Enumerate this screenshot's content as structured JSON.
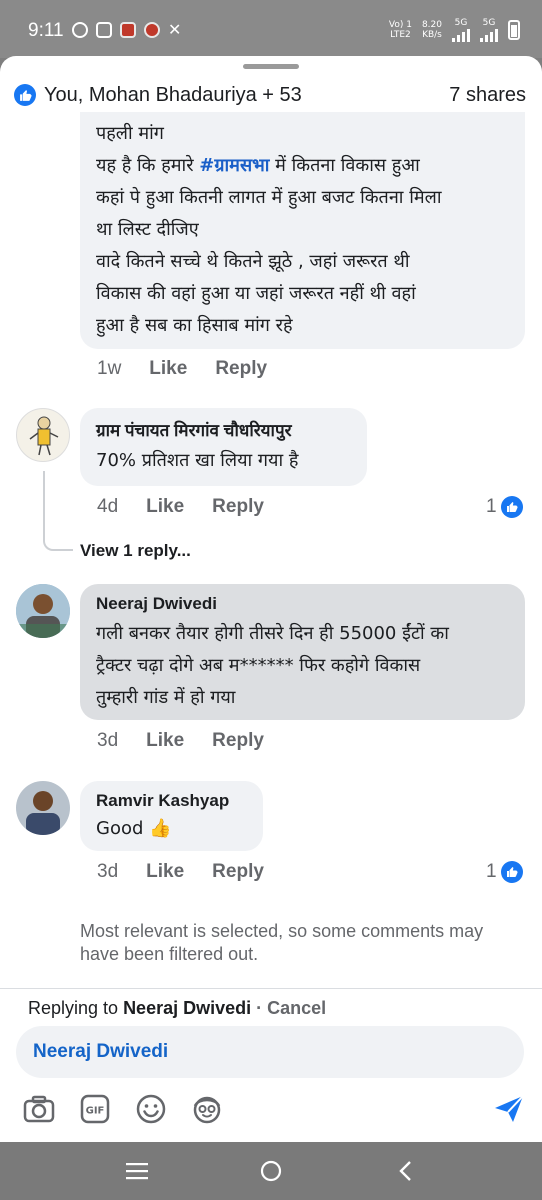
{
  "status_bar": {
    "time": "9:11",
    "network_label": "Vo) 1\nLTE2",
    "speed": "8.20",
    "speed_unit": "KB/s",
    "sim1": "5G",
    "sim2": "5G"
  },
  "header": {
    "reactions": "You, Mohan Bhadauriya + 53",
    "shares": "7 shares"
  },
  "comments": [
    {
      "lines": [
        "पहली मांग",
        "यह है कि हमारे ",
        "#ग्रामसभा",
        " में कितना विकास हुआ",
        "कहां पे हुआ कितनी लागत में हुआ बजट कितना मिला",
        "था लिस्ट दीजिए",
        "वादे कितने सच्चे थे कितने झूठे , जहां जरूरत थी",
        "विकास की वहां हुआ या जहां जरूरत नहीं थी वहां",
        "हुआ है सब का हिसाब मांग रहे"
      ],
      "time": "1w",
      "like": "Like",
      "reply": "Reply"
    },
    {
      "author": "ग्राम पंचायत मिरगांव चौधरियापुर",
      "text": "70% प्रतिशत खा लिया गया है",
      "time": "4d",
      "like": "Like",
      "reply": "Reply",
      "likes_count": "1",
      "view_replies": "View 1 reply..."
    },
    {
      "author": "Neeraj Dwivedi",
      "lines": [
        "गली बनकर तैयार होगी तीसरे दिन ही 55000 ईंटों का",
        "ट्रैक्टर चढ़ा दोगे अब म****** फिर कहोगे विकास",
        "तुम्हारी गांड में हो गया"
      ],
      "time": "3d",
      "like": "Like",
      "reply": "Reply"
    },
    {
      "author": "Ramvir Kashyap",
      "text": "Good 👍",
      "time": "3d",
      "like": "Like",
      "reply": "Reply",
      "likes_count": "1"
    }
  ],
  "filter_note": "Most relevant is selected, so some comments may have been filtered out.",
  "reply_bar": {
    "prefix": "Replying to ",
    "name": "Neeraj Dwivedi",
    "separator": " · ",
    "cancel": "Cancel",
    "input_value": "Neeraj Dwivedi"
  },
  "icons": {
    "camera": "camera-icon",
    "gif": "gif-icon",
    "emoji": "emoji-icon",
    "avatar_sticker": "avatar-sticker-icon",
    "send": "send-icon"
  },
  "colors": {
    "accent": "#1877f2",
    "link_text": "#1464c8",
    "bubble": "#f0f2f5",
    "bubble_selected": "#dcdee1"
  }
}
